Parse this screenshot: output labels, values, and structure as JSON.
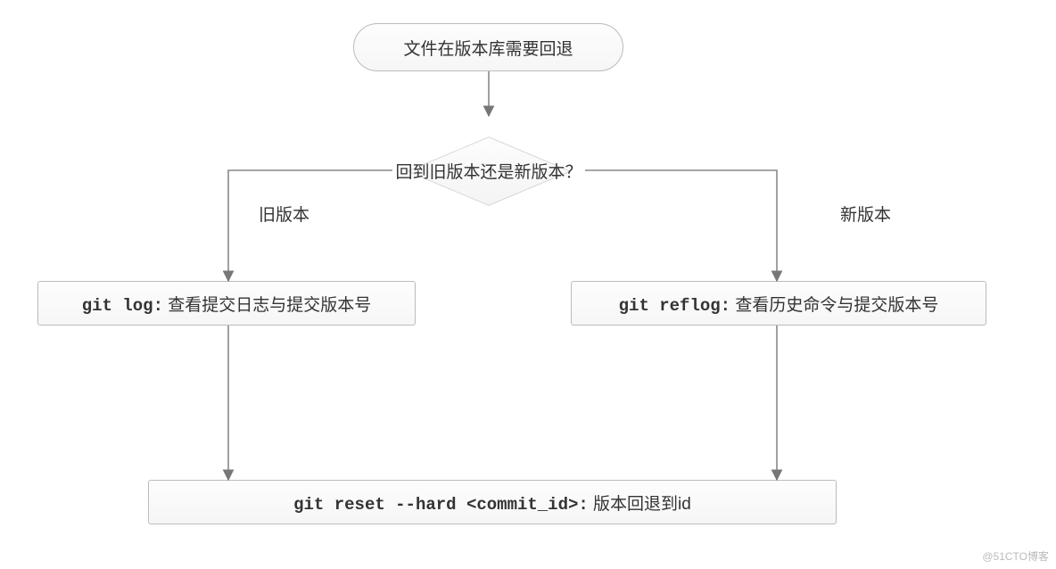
{
  "nodes": {
    "start": "文件在版本库需要回退",
    "decision": "回到旧版本还是新版本？",
    "left": {
      "code": "git log:",
      "text": " 查看提交日志与提交版本号"
    },
    "right": {
      "code": "git reflog:",
      "text": " 查看历史命令与提交版本号"
    },
    "bottom": {
      "code": "git reset --hard <commit_id>:",
      "text": " 版本回退到id"
    }
  },
  "labels": {
    "old": "旧版本",
    "new": "新版本"
  },
  "watermark": "@51CTO博客"
}
